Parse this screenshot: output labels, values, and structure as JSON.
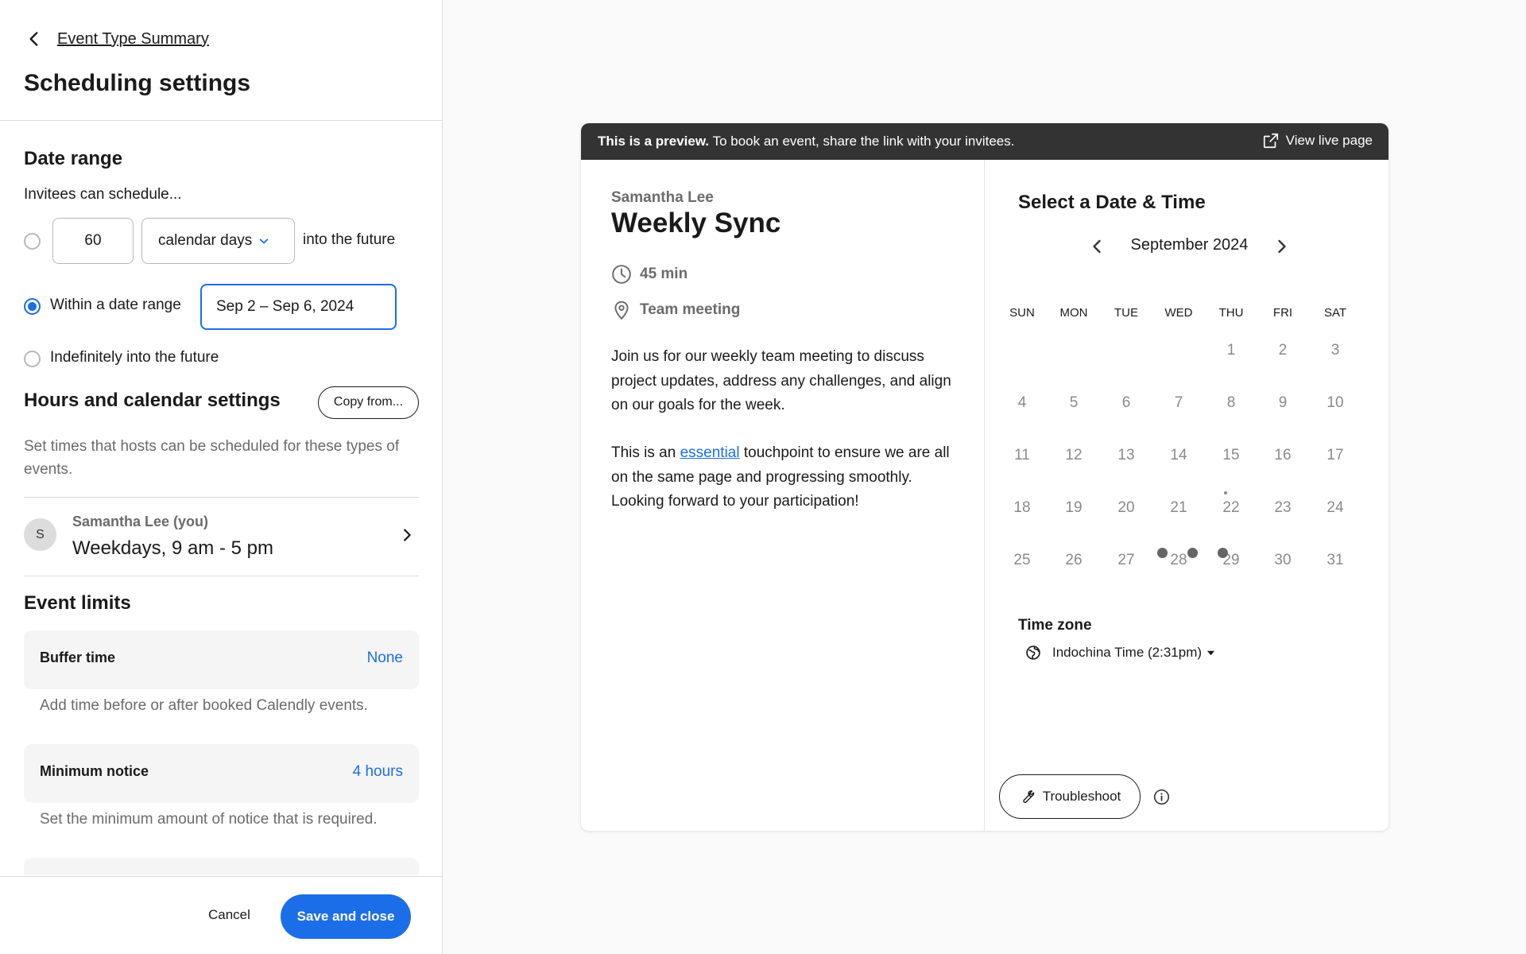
{
  "header": {
    "back_label": "Event Type Summary",
    "title": "Scheduling settings"
  },
  "date_range": {
    "title": "Date range",
    "intro": "Invitees can schedule...",
    "days_value": "60",
    "unit_selected": "calendar days",
    "future_suffix": "into the future",
    "within_label": "Within a date range",
    "range_value": "Sep 2 – Sep 6, 2024",
    "indefinite_label": "Indefinitely into the future",
    "selected_option": "within"
  },
  "hours": {
    "title": "Hours and calendar settings",
    "copy_label": "Copy from...",
    "description": "Set times that hosts can be scheduled for these types of events.",
    "host_initial": "S",
    "host_name": "Samantha Lee (you)",
    "host_hours": "Weekdays, 9 am - 5 pm"
  },
  "limits": {
    "title": "Event limits",
    "buffer_label": "Buffer time",
    "buffer_value": "None",
    "buffer_desc": "Add time before or after booked Calendly events.",
    "notice_label": "Minimum notice",
    "notice_value": "4 hours",
    "notice_desc": "Set the minimum amount of notice that is required."
  },
  "footer": {
    "cancel_label": "Cancel",
    "save_label": "Save and close"
  },
  "preview": {
    "note_bold": "This is a preview.",
    "note_rest": " To book an event, share the link with your invitees.",
    "view_live_label": "View live page",
    "host": "Samantha Lee",
    "event_title": "Weekly Sync",
    "duration": "45 min",
    "location": "Team meeting",
    "desc_p1": "Join us for our weekly team meeting to discuss project updates, address any challenges, and align on our goals for the week.",
    "desc_p2_before": "This is an ",
    "desc_p2_link": "essential",
    "desc_p2_after": " touchpoint to ensure we are all on the same page and progressing smoothly. Looking forward to your participation!"
  },
  "calendar": {
    "title": "Select a Date & Time",
    "month": "September 2024",
    "weekdays": [
      "SUN",
      "MON",
      "TUE",
      "WED",
      "THU",
      "FRI",
      "SAT"
    ],
    "rows": [
      [
        "",
        "",
        "",
        "1",
        "2",
        "3"
      ],
      [
        "4",
        "5",
        "6",
        "7",
        "8",
        "9",
        "10"
      ],
      [
        "11",
        "12",
        "13",
        "14",
        "15",
        "16",
        "17"
      ],
      [
        "18",
        "19",
        "20",
        "21",
        "22",
        "23",
        "24"
      ],
      [
        "25",
        "26",
        "27",
        "28",
        "29",
        "30",
        "31"
      ]
    ],
    "tz_title": "Time zone",
    "tz_value": "Indochina Time (2:31pm)",
    "troubleshoot_label": "Troubleshoot"
  },
  "colors": {
    "accent": "#1c6ee8",
    "preview_bar": "#333333",
    "day_disabled": "#8a8a8a"
  },
  "icons": [
    "chevron-left-icon",
    "chevron-down-icon",
    "chevron-right-icon",
    "external-link-icon",
    "clock-icon",
    "location-pin-icon",
    "globe-icon",
    "wrench-icon",
    "info-icon",
    "caret-down-icon"
  ]
}
